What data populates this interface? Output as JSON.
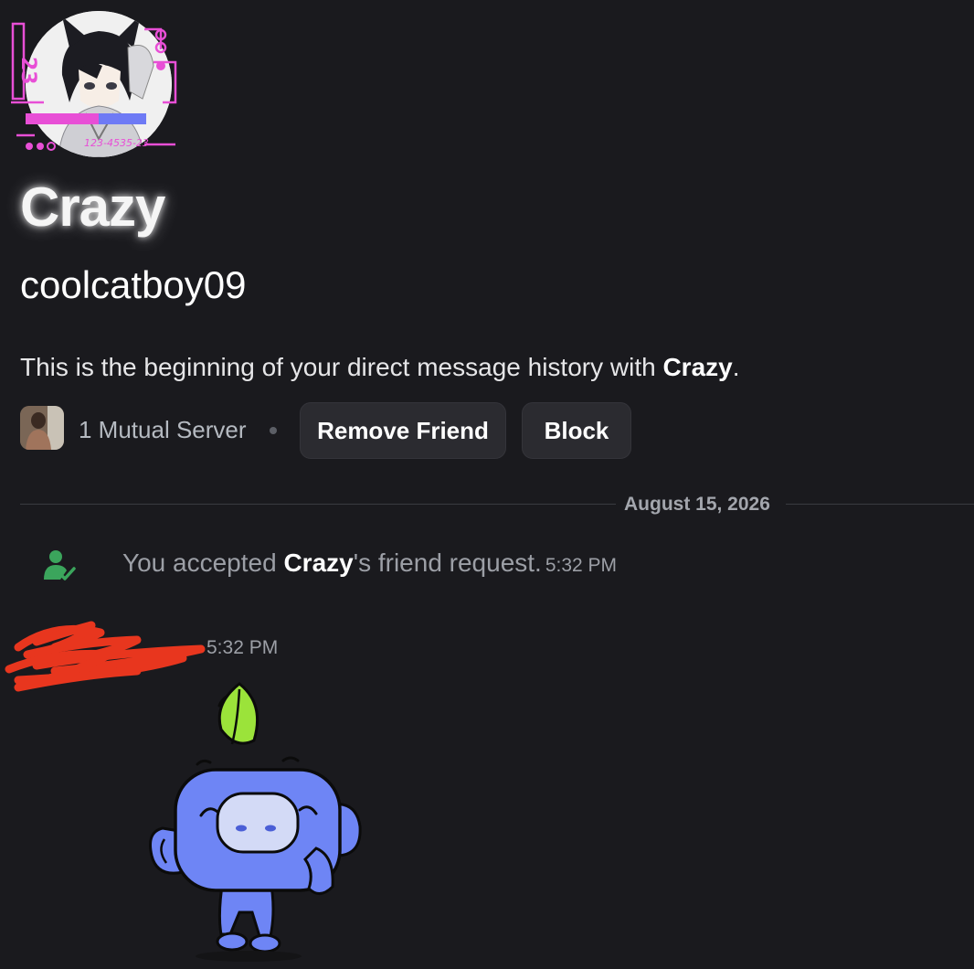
{
  "profile": {
    "display_name": "Crazy",
    "username": "coolcatboy09",
    "avatar_icon": "anime-avatar-icon",
    "avatar_decoration_text": "23",
    "avatar_decoration_code": "123-4535-23"
  },
  "intro": {
    "prefix": "This is the beginning of your direct message history with ",
    "name": "Crazy",
    "suffix": "."
  },
  "actions": {
    "mutual_servers": "1 Mutual Server",
    "remove_friend": "Remove Friend",
    "block": "Block"
  },
  "divider": {
    "date": "August 15, 2026"
  },
  "system_message": {
    "prefix": "You accepted ",
    "name": "Crazy",
    "suffix": "'s friend request.",
    "time": "5:32 PM"
  },
  "message": {
    "time": "5:32 PM",
    "sticker": "wumpus-leaf-sticker"
  },
  "colors": {
    "background": "#1a1a1e",
    "button": "#2b2b30",
    "accent_green": "#3ba55c",
    "decoration_pink": "#e84fd6",
    "wumpus_blue": "#6e85f5",
    "leaf_green": "#9be33a",
    "scribble_red": "#e8361e"
  }
}
